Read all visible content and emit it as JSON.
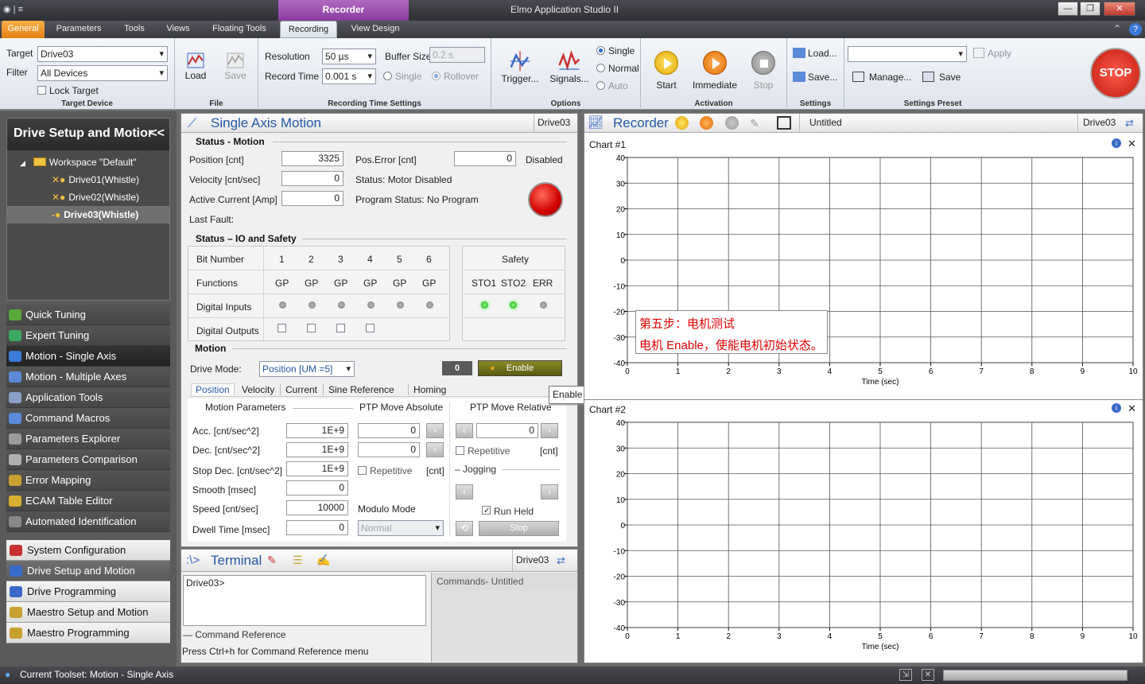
{
  "window": {
    "title": "Elmo Application Studio II",
    "context_tab": "Recorder"
  },
  "tabs": [
    {
      "label": "General"
    },
    {
      "label": "Parameters"
    },
    {
      "label": "Tools"
    },
    {
      "label": "Views"
    },
    {
      "label": "Floating Tools"
    },
    {
      "label": "Recording"
    },
    {
      "label": "View Design"
    }
  ],
  "ribbon": {
    "target_device": {
      "target_label": "Target",
      "target_value": "Drive03",
      "filter_label": "Filter",
      "filter_value": "All Devices",
      "lock_label": "Lock Target",
      "group": "Target Device"
    },
    "file": {
      "load": "Load",
      "save": "Save",
      "group": "File"
    },
    "recording_time": {
      "resolution_label": "Resolution",
      "resolution_value": "50 µs",
      "record_time_label": "Record Time",
      "record_time_value": "0.001 s",
      "buffer_label": "Buffer Size",
      "buffer_value": "0.2 s",
      "single": "Single",
      "rollover": "Rollover",
      "group": "Recording Time Settings"
    },
    "options": {
      "trigger": "Trigger...",
      "signals": "Signals...",
      "single": "Single",
      "normal": "Normal",
      "auto": "Auto",
      "group": "Options"
    },
    "activation": {
      "start": "Start",
      "immediate": "Immediate",
      "stop": "Stop",
      "group": "Activation"
    },
    "settings": {
      "load": "Load...",
      "save": "Save...",
      "group": "Settings"
    },
    "settings_preset": {
      "apply": "Apply",
      "manage": "Manage...",
      "save": "Save",
      "group": "Settings Preset"
    },
    "stop_button": "STOP"
  },
  "left": {
    "header": "Drive Setup and Motior",
    "header_chevron": "<<",
    "tree": [
      {
        "label": "Workspace \"Default\""
      },
      {
        "label": "Drive01(Whistle)"
      },
      {
        "label": "Drive02(Whistle)"
      },
      {
        "label": "Drive03(Whistle)"
      }
    ],
    "nav": [
      {
        "label": "Quick Tuning",
        "color": "#58a83a"
      },
      {
        "label": "Expert Tuning",
        "color": "#3aa860"
      },
      {
        "label": "Motion - Single Axis",
        "color": "#3a7ad8"
      },
      {
        "label": "Motion - Multiple Axes",
        "color": "#5a8ad8"
      },
      {
        "label": "Application Tools",
        "color": "#8aa0c8"
      },
      {
        "label": "Command Macros",
        "color": "#5a8ad8"
      },
      {
        "label": "Parameters Explorer",
        "color": "#9a9a9a"
      },
      {
        "label": "Parameters Comparison",
        "color": "#b0b0b0"
      },
      {
        "label": "Error Mapping",
        "color": "#c8a030"
      },
      {
        "label": "ECAM Table Editor",
        "color": "#d8b030"
      },
      {
        "label": "Automated Identification",
        "color": "#888888"
      }
    ],
    "toolsets": [
      {
        "label": "System Configuration",
        "color": "#c83030"
      },
      {
        "label": "Drive Setup and Motion",
        "color": "#3a6ac8"
      },
      {
        "label": "Drive Programming",
        "color": "#3a6ac8"
      },
      {
        "label": "Maestro Setup and Motion",
        "color": "#c8a030"
      },
      {
        "label": "Maestro Programming",
        "color": "#c8a030"
      }
    ]
  },
  "single_axis": {
    "title": "Single Axis Motion",
    "drive": "Drive03",
    "status_motion": "Status - Motion",
    "position_label": "Position  [cnt]",
    "position_value": "3325",
    "velocity_label": "Velocity  [cnt/sec]",
    "velocity_value": "0",
    "current_label": "Active Current [Amp]",
    "current_value": "0",
    "last_fault_label": "Last Fault:",
    "pos_error_label": "Pos.Error   [cnt]",
    "pos_error_value": "0",
    "disabled_label": "Disabled",
    "status_label": "Status: Motor Disabled",
    "program_status_label": "Program Status:  No Program",
    "status_io": "Status – IO and Safety",
    "bit_number": "Bit Number",
    "bits": [
      "1",
      "2",
      "3",
      "4",
      "5",
      "6"
    ],
    "functions": "Functions",
    "gp": [
      "GP",
      "GP",
      "GP",
      "GP",
      "GP",
      "GP"
    ],
    "digital_inputs": "Digital Inputs",
    "digital_outputs": "Digital Outputs",
    "safety": "Safety",
    "safety_items": [
      "STO1",
      "STO2",
      "ERR"
    ],
    "motion": "Motion",
    "drive_mode_label": "Drive Mode:",
    "drive_mode_value": "Position [UM =5]",
    "counter": "0",
    "enable": "Enable",
    "tooltip": "Enable Motor Init State",
    "subtabs": [
      "Position",
      "Velocity",
      "Current",
      "Sine Reference",
      "Homing"
    ],
    "motion_params": "Motion Parameters",
    "ptp_abs": "PTP Move Absolute",
    "ptp_rel": "PTP Move Relative",
    "params": [
      {
        "label": "Acc. [cnt/sec^2]",
        "value": "1E+9"
      },
      {
        "label": "Dec. [cnt/sec^2]",
        "value": "1E+9"
      },
      {
        "label": "Stop Dec. [cnt/sec^2]",
        "value": "1E+9"
      },
      {
        "label": "Smooth [msec]",
        "value": "0"
      },
      {
        "label": "Speed [cnt/sec]",
        "value": "10000"
      },
      {
        "label": "Dwell Time [msec]",
        "value": "0"
      }
    ],
    "abs_value1": "0",
    "abs_value2": "0",
    "repetitive": "Repetitive",
    "cnt": "[cnt]",
    "modulo_mode": "Modulo Mode",
    "modulo_value": "Normal",
    "rel_value": "0",
    "jogging": "Jogging",
    "run_held": "Run Held",
    "stop": "Stop"
  },
  "terminal": {
    "title": "Terminal",
    "drive": "Drive03",
    "prompt": "Drive03>",
    "commands": "Commands- Untitled",
    "cmd_ref": "Command Reference",
    "hint": "Press Ctrl+h for Command Reference menu"
  },
  "recorder": {
    "title": "Recorder",
    "file": "Untitled",
    "drive": "Drive03",
    "charts": [
      {
        "title": "Chart #1"
      },
      {
        "title": "Chart #2"
      }
    ],
    "annotation_line1": "第五步：电机测试",
    "annotation_line2": "电机 Enable，使能电机初始状态。"
  },
  "chart_data": [
    {
      "type": "line",
      "title": "Chart #1",
      "xlabel": "Time (sec)",
      "ylabel": "",
      "xlim": [
        0,
        10
      ],
      "ylim": [
        -40,
        40
      ],
      "x_ticks": [
        "0",
        "1",
        "2",
        "3",
        "4",
        "5",
        "6",
        "7",
        "8",
        "9",
        "10"
      ],
      "y_ticks": [
        "40",
        "30",
        "20",
        "10",
        "0",
        "-10",
        "-20",
        "-30",
        "-40"
      ],
      "series": [],
      "grid": true
    },
    {
      "type": "line",
      "title": "Chart #2",
      "xlabel": "Time (sec)",
      "ylabel": "",
      "xlim": [
        0,
        10
      ],
      "ylim": [
        -40,
        40
      ],
      "x_ticks": [
        "0",
        "1",
        "2",
        "3",
        "4",
        "5",
        "6",
        "7",
        "8",
        "9",
        "10"
      ],
      "y_ticks": [
        "40",
        "30",
        "20",
        "10",
        "0",
        "-10",
        "-20",
        "-30",
        "-40"
      ],
      "series": [],
      "grid": true
    }
  ],
  "status_bar": {
    "text": "Current Toolset: Motion - Single Axis"
  }
}
